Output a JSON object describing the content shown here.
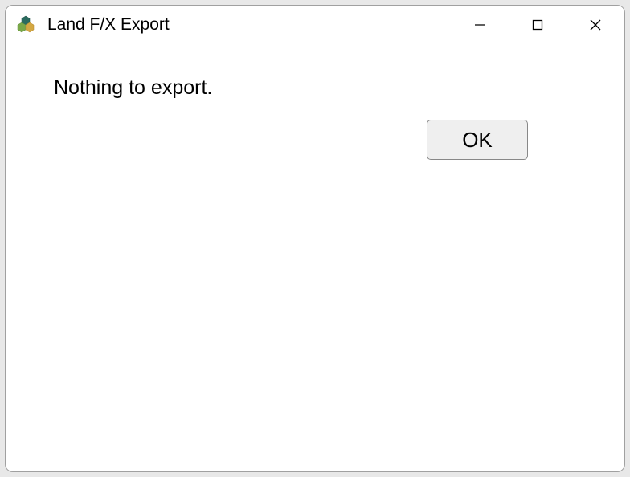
{
  "window": {
    "title": "Land F/X Export"
  },
  "content": {
    "message": "Nothing to export.",
    "ok_label": "OK"
  },
  "icons": {
    "app": "hexagon-cluster-icon",
    "minimize": "minimize-icon",
    "maximize": "maximize-icon",
    "close": "close-icon"
  }
}
